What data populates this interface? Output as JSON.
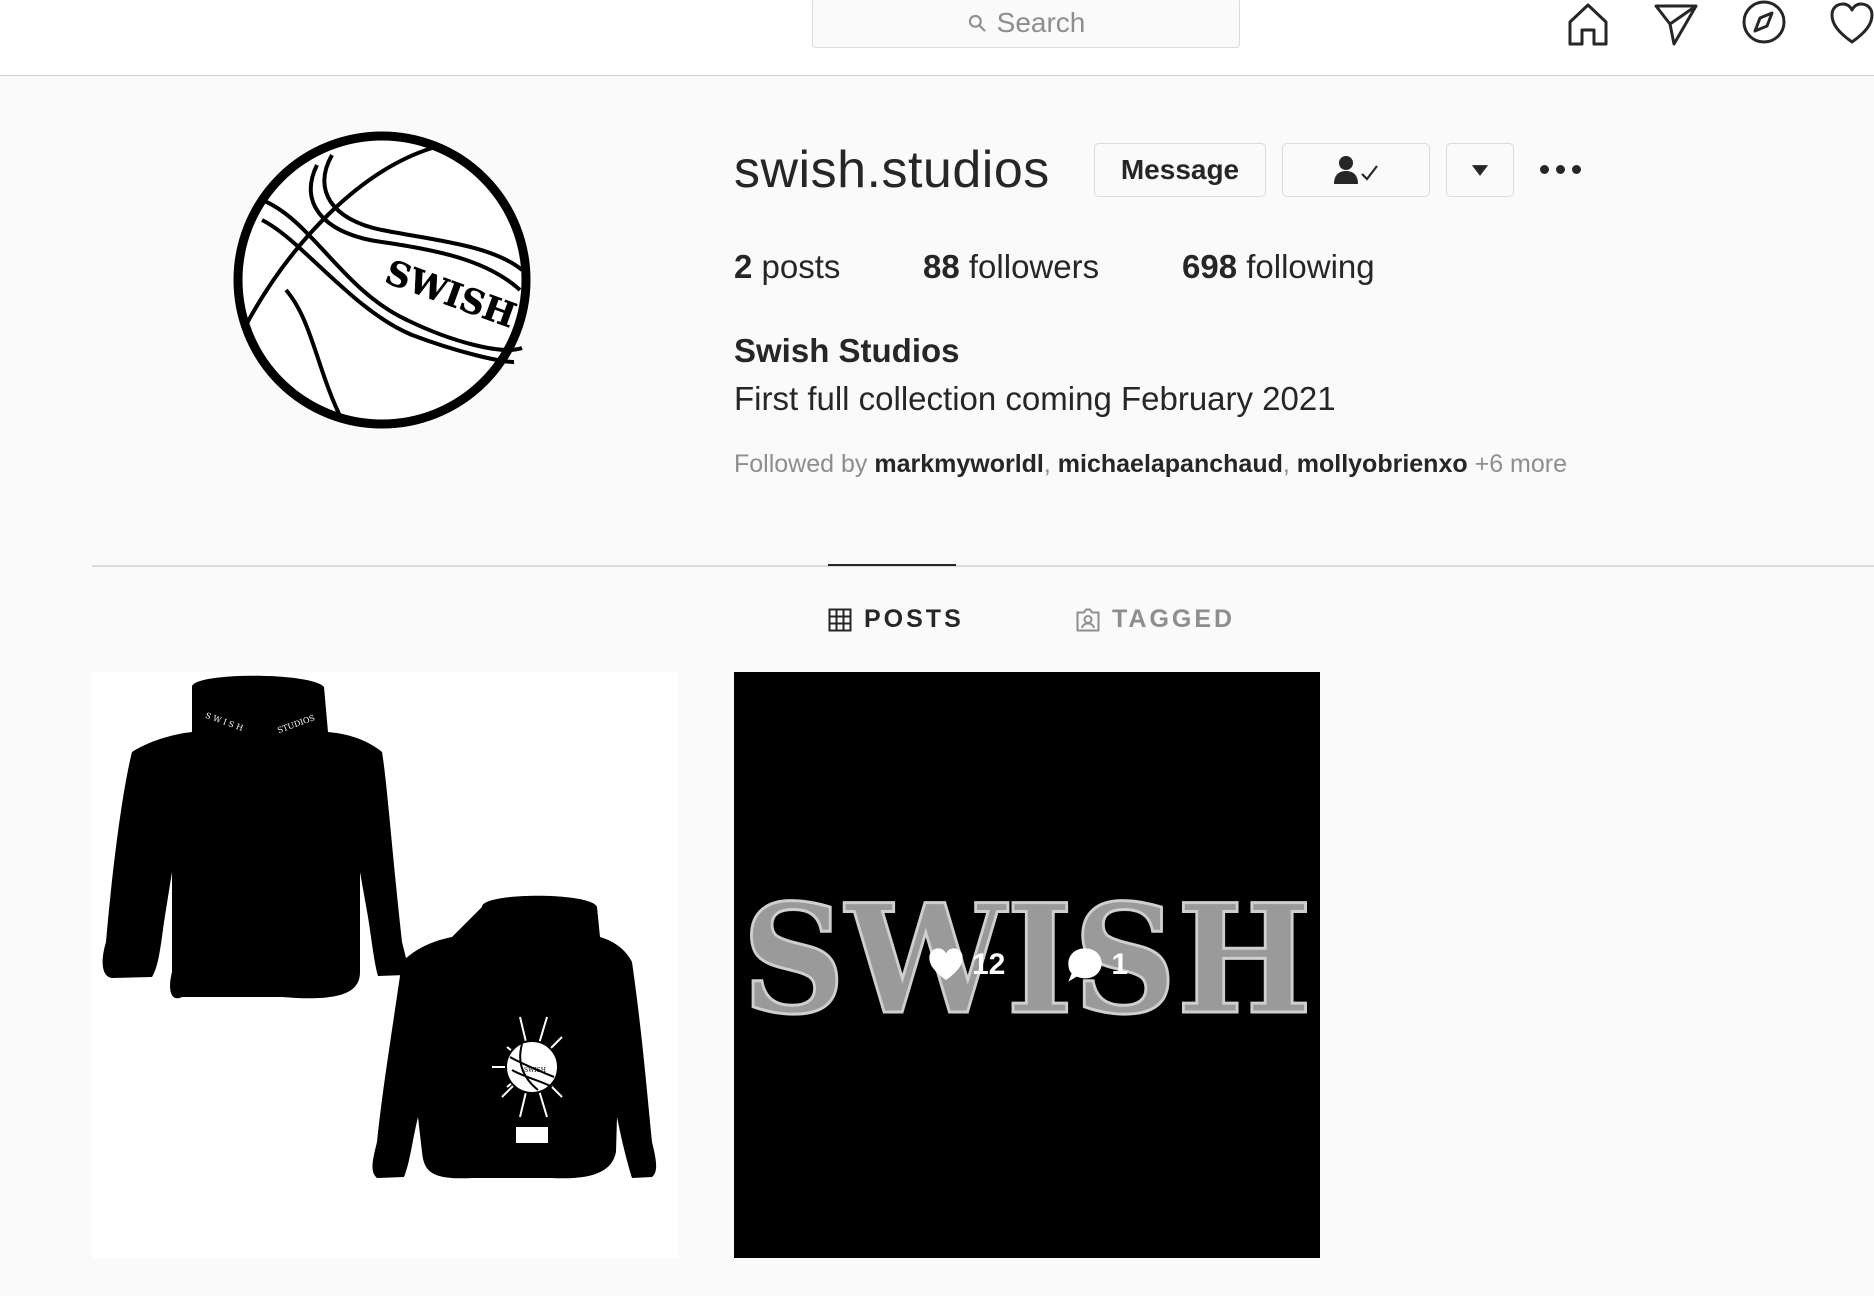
{
  "search": {
    "placeholder": "Search"
  },
  "nav": {
    "icons": [
      "home-icon",
      "direct-message-icon",
      "explore-icon",
      "activity-heart-icon"
    ]
  },
  "profile": {
    "username": "swish.studios",
    "message_button": "Message",
    "stats": {
      "posts_count": "2",
      "posts_label": "posts",
      "followers_count": "88",
      "followers_label": "followers",
      "following_count": "698",
      "following_label": "following"
    },
    "full_name": "Swish Studios",
    "bio": "First full collection coming February 2021",
    "followed_by": {
      "prefix": "Followed by",
      "users": [
        "markmyworldl",
        "michaelapanchaud",
        "mollyobrienxo"
      ],
      "more": "+6 more"
    },
    "avatar_text": "SWISH"
  },
  "tabs": [
    {
      "label": "POSTS",
      "icon": "grid-icon",
      "active": true
    },
    {
      "label": "TAGGED",
      "icon": "tagged-icon",
      "active": false
    }
  ],
  "posts": [
    {
      "type": "image",
      "subject": "hoodie-mockup",
      "hoodie_neck_text_left": "S W I S H",
      "hoodie_neck_text_right": "STUDIOS",
      "hoodie_back_logo_text": "SWISH"
    },
    {
      "type": "image",
      "subject": "swish-logo",
      "logo_text": "SWISH",
      "likes": "12",
      "comments": "1"
    }
  ],
  "colors": {
    "text": "#262626",
    "secondary": "#8e8e8e",
    "border": "#dbdbdb",
    "background": "#fafafa"
  }
}
